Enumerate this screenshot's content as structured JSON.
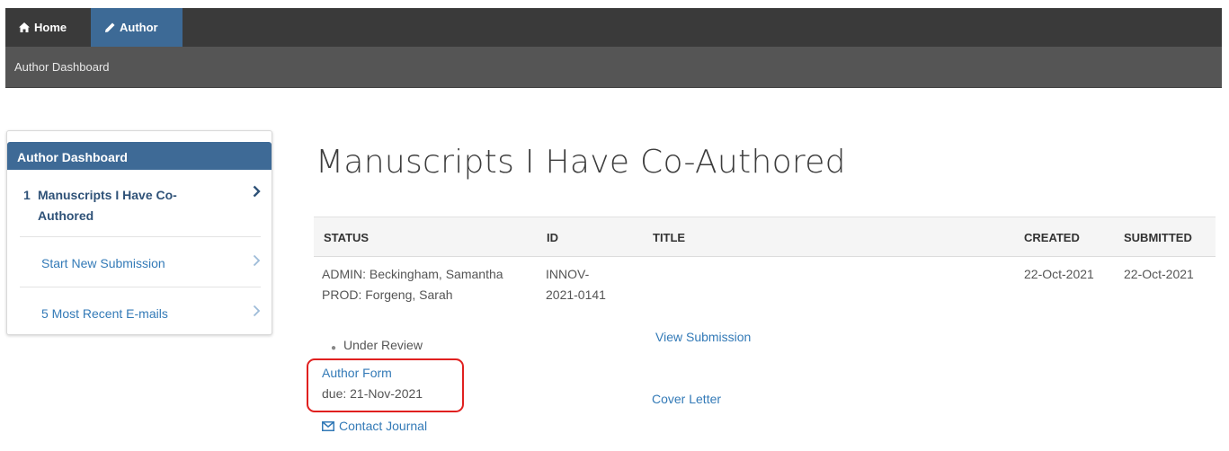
{
  "nav": {
    "home_label": "Home",
    "author_label": "Author",
    "home_icon": "home-icon",
    "author_icon": "pencil-icon"
  },
  "subnav": {
    "label": "Author Dashboard"
  },
  "sidebar": {
    "title": "Author Dashboard",
    "items": [
      {
        "count": "1",
        "label": "Manuscripts I Have Co-Authored",
        "active": true
      },
      {
        "count": "",
        "label": "Start New Submission",
        "active": false
      },
      {
        "count": "",
        "label": "5 Most Recent E-mails",
        "active": false
      }
    ]
  },
  "main": {
    "title": "Manuscripts I Have Co-Authored",
    "table": {
      "headers": [
        "STATUS",
        "ID",
        "TITLE",
        "CREATED",
        "SUBMITTED"
      ],
      "row": {
        "admin": "ADMIN: Beckingham, Samantha",
        "prod": "PROD: Forgeng, Sarah",
        "id_line1": "INNOV-",
        "id_line2": "2021-0141",
        "created": "22-Oct-2021",
        "submitted": "22-Oct-2021",
        "status": "Under Review",
        "author_form": "Author Form",
        "due": "due: 21-Nov-2021",
        "contact_journal": "Contact Journal",
        "view_submission": "View Submission",
        "cover_letter": "Cover Letter"
      }
    }
  },
  "colors": {
    "nav_bg": "#3a3a3a",
    "nav_active": "#3d6a96",
    "subnav_bg": "#555555",
    "link": "#337ab7",
    "highlight": "#e0201f"
  }
}
